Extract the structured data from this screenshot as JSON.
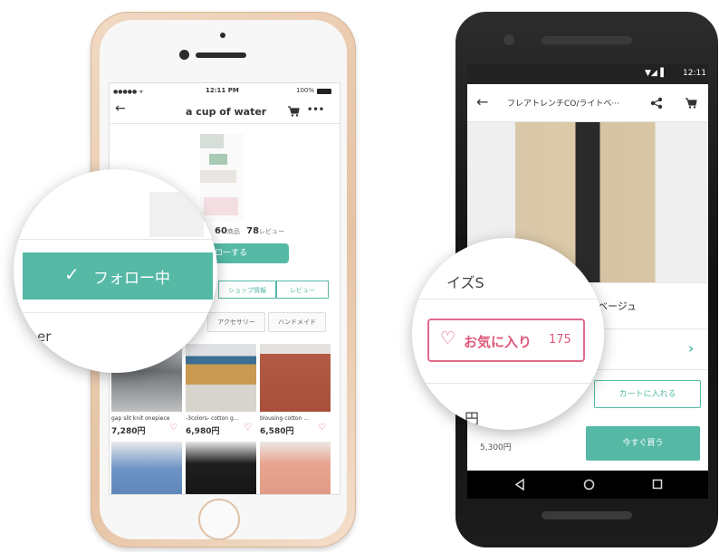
{
  "iphone": {
    "status": {
      "carrier": "●●●●● ᯤ",
      "time": "12:11 PM",
      "battery": "100%"
    },
    "header": {
      "title": "a cup of water",
      "back": "←",
      "more": "•••"
    },
    "stats": {
      "items_count": "60",
      "items_unit": "商品",
      "reviews_count": "78",
      "reviews_unit": "レビュー"
    },
    "follow_button": "ロ一する",
    "tabs": [
      "ショップ情報",
      "レビュー"
    ],
    "categories": [
      "アクセサリー",
      "ハンドメイド"
    ],
    "products": [
      {
        "name": "gap slit knit onepiece",
        "price": "7,280円"
      },
      {
        "name": "-3colors- cotton g...",
        "price": "6,980円"
      },
      {
        "name": "blousing cotton ...",
        "price": "6,580円"
      }
    ],
    "magnifier": {
      "follow_label": "フォロー中",
      "check": "✓",
      "fragment": "er"
    }
  },
  "android": {
    "status_time": "12:11",
    "toolbar_title": "フレアトレンチCO/ライトベ···",
    "color_label": "ベージュ",
    "add_to_cart": "カートに入れる",
    "buy_now": "今すぐ買う",
    "price": "5,300円",
    "magnifier": {
      "size_label": "イズS",
      "favorite_label": "お気に入り",
      "favorite_count": "175",
      "price_fragment": "円"
    }
  },
  "colors": {
    "teal": "#55b9a6",
    "pink": "#e0587a"
  },
  "icons": [
    "back-arrow-icon",
    "cart-icon",
    "more-icon",
    "share-icon",
    "heart-icon",
    "check-icon",
    "chevron-right-icon",
    "nav-back-icon",
    "nav-home-icon",
    "nav-recents-icon"
  ]
}
